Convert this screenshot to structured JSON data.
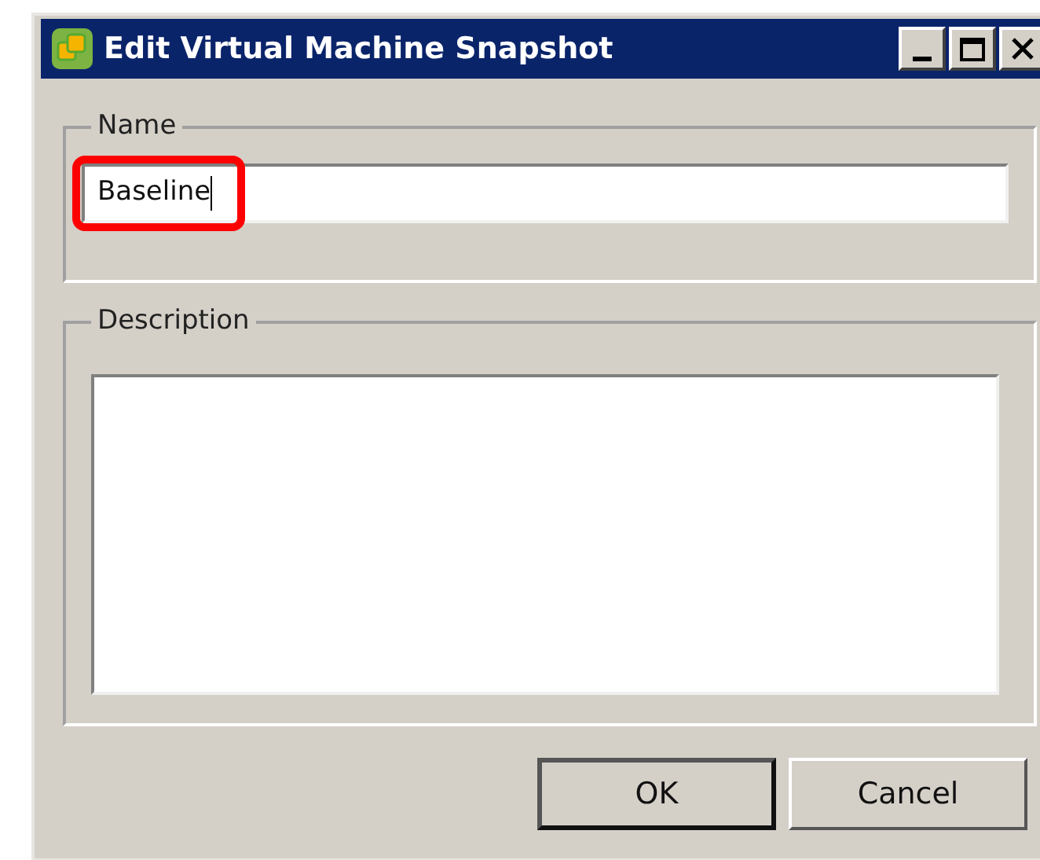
{
  "window": {
    "title": "Edit Virtual Machine Snapshot"
  },
  "name_group": {
    "label": "Name",
    "value": "Baseline",
    "highlighted": true
  },
  "description_group": {
    "label": "Description"
  },
  "buttons": [
    {
      "label": "OK",
      "default": true
    },
    {
      "label": "Cancel",
      "default": false
    }
  ]
}
